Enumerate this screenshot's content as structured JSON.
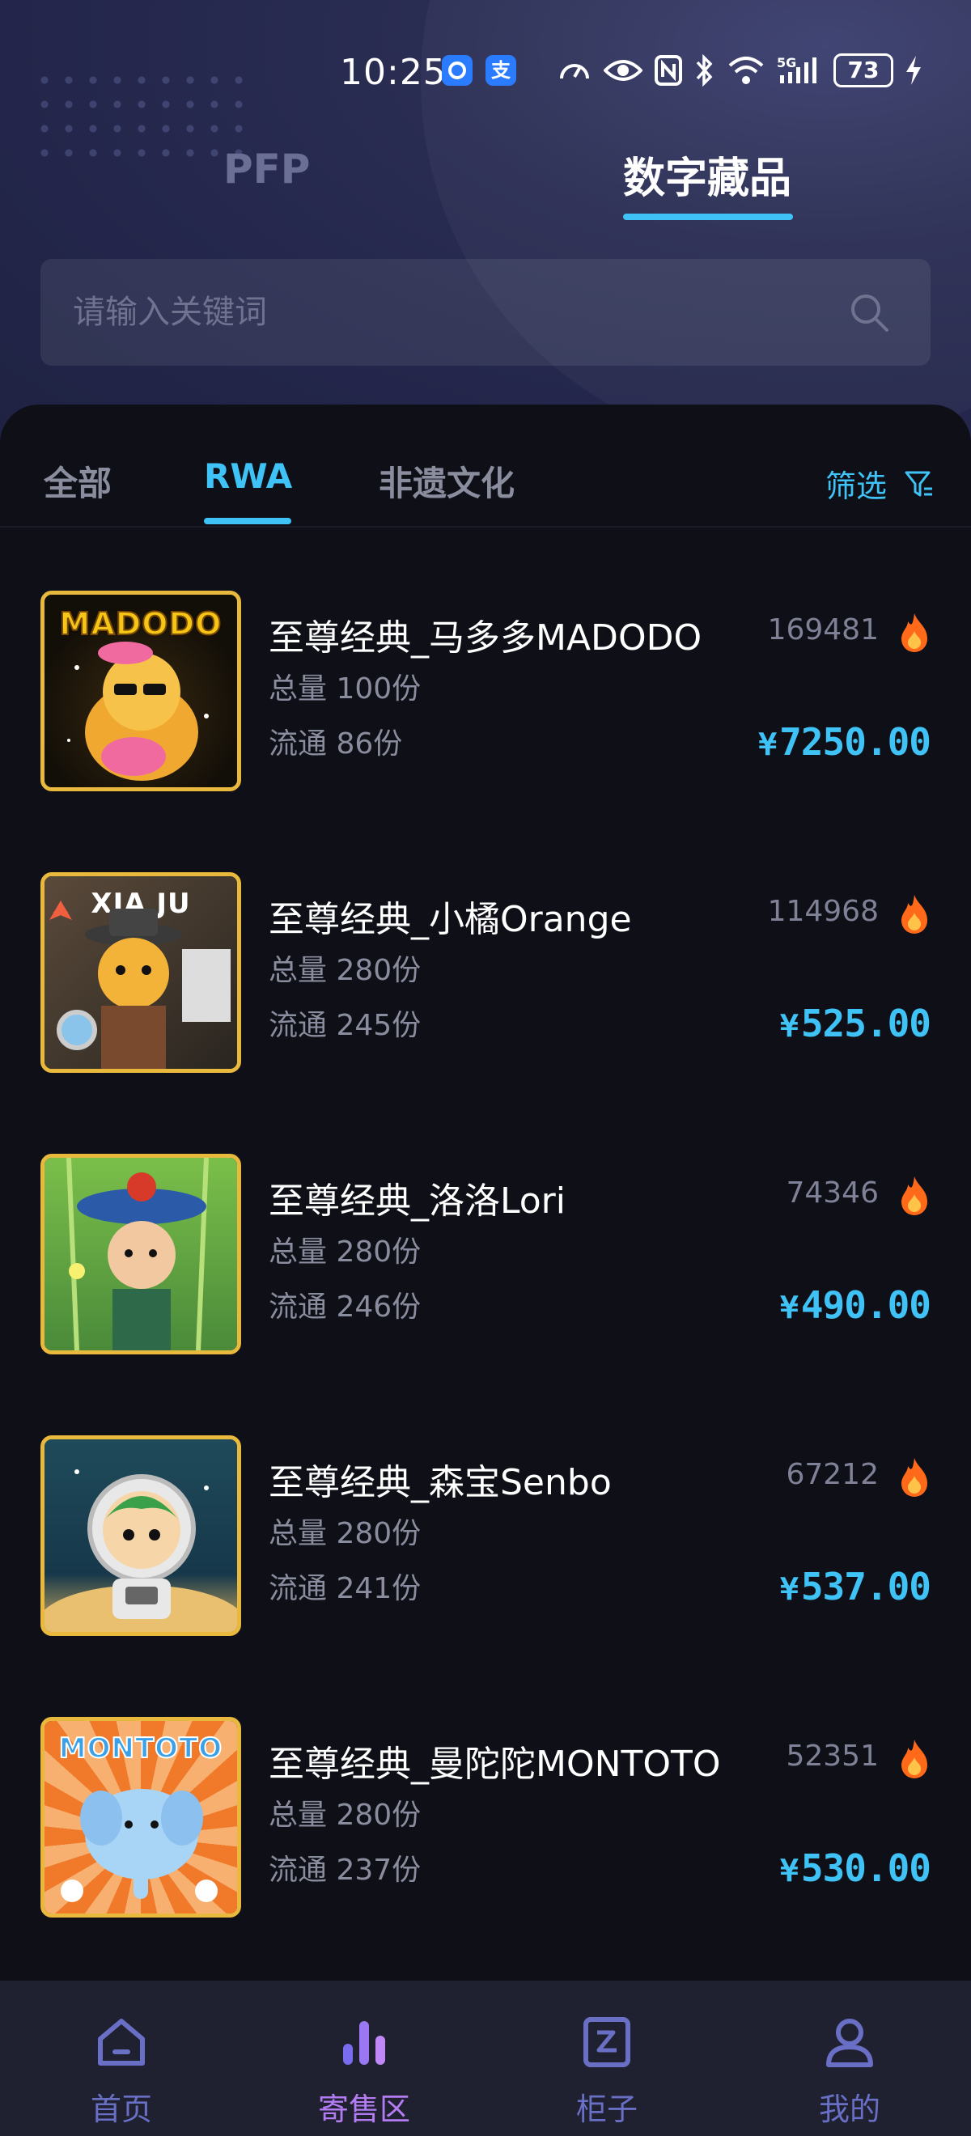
{
  "status_bar": {
    "time": "10:25",
    "app_badge_2": "支",
    "battery": "73"
  },
  "top_tabs": {
    "pfp": "PFP",
    "digital": "数字藏品"
  },
  "search": {
    "placeholder": "请输入关键词"
  },
  "sub_tabs": {
    "all": "全部",
    "rwa": "RWA",
    "heritage": "非遗文化",
    "filter": "筛选"
  },
  "items": [
    {
      "title": "至尊经典_马多多MADODO",
      "total": "总量 100份",
      "float": "流通 86份",
      "heat": "169481",
      "price": "7250.00",
      "thumb_text": "MADODO"
    },
    {
      "title": "至尊经典_小橘Orange",
      "total": "总量 280份",
      "float": "流通 245份",
      "heat": "114968",
      "price": "525.00",
      "thumb_text": "XIA JU"
    },
    {
      "title": "至尊经典_洛洛Lori",
      "total": "总量 280份",
      "float": "流通 246份",
      "heat": "74346",
      "price": "490.00",
      "thumb_text": ""
    },
    {
      "title": "至尊经典_森宝Senbo",
      "total": "总量 280份",
      "float": "流通 241份",
      "heat": "67212",
      "price": "537.00",
      "thumb_text": ""
    },
    {
      "title": "至尊经典_曼陀陀MONTOTO",
      "total": "总量 280份",
      "float": "流通 237份",
      "heat": "52351",
      "price": "530.00",
      "thumb_text": "MONTOTO"
    }
  ],
  "currency": "¥",
  "bottom_nav": {
    "home": "首页",
    "consign": "寄售区",
    "cabinet": "柜子",
    "mine": "我的"
  },
  "colors": {
    "accent": "#3fc2f5",
    "nav_active": "#b47cf3",
    "nav_inactive": "#6a6fc6",
    "fire": "#ff6a1a"
  }
}
